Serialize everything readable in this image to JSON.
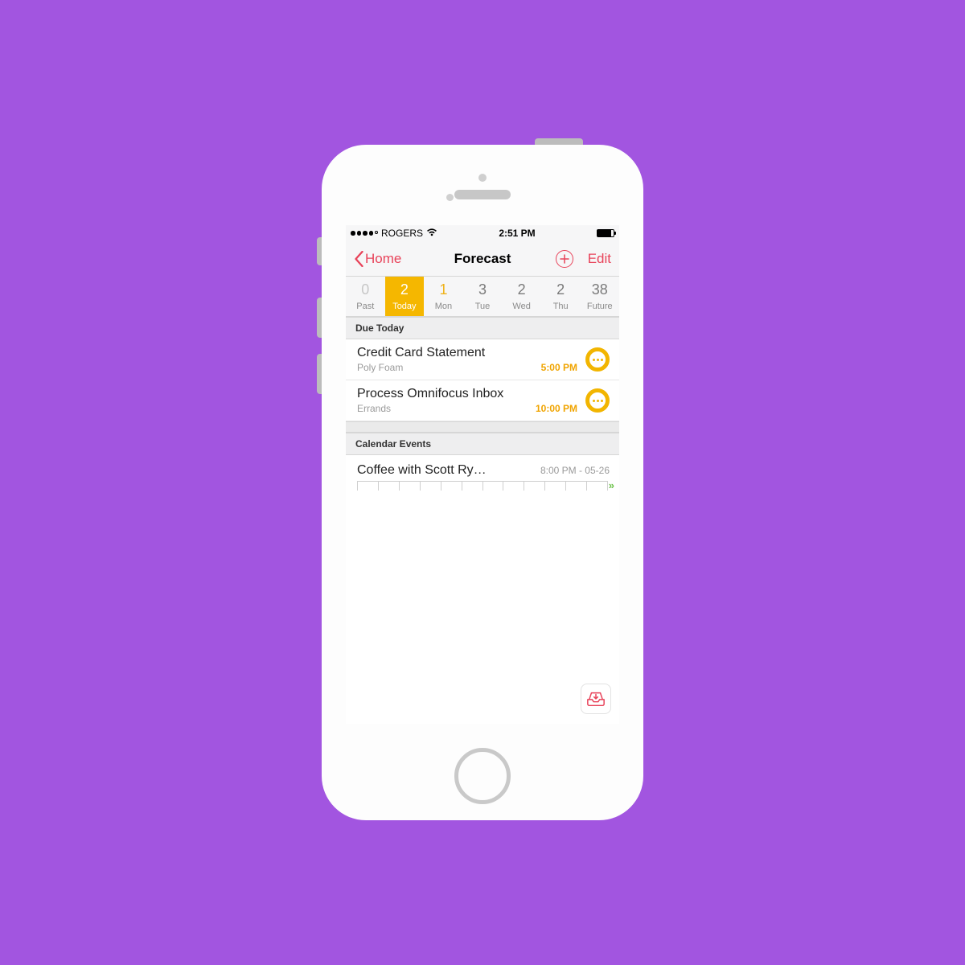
{
  "status_bar": {
    "carrier": "ROGERS",
    "time": "2:51 PM"
  },
  "nav": {
    "back_label": "Home",
    "title": "Forecast",
    "edit_label": "Edit"
  },
  "days": [
    {
      "count": "0",
      "label": "Past",
      "kind": "past"
    },
    {
      "count": "2",
      "label": "Today",
      "kind": "selected"
    },
    {
      "count": "1",
      "label": "Mon",
      "kind": "upcoming"
    },
    {
      "count": "3",
      "label": "Tue",
      "kind": "normal"
    },
    {
      "count": "2",
      "label": "Wed",
      "kind": "normal"
    },
    {
      "count": "2",
      "label": "Thu",
      "kind": "normal"
    },
    {
      "count": "38",
      "label": "Future",
      "kind": "normal"
    }
  ],
  "sections": {
    "due_today_header": "Due Today",
    "calendar_header": "Calendar Events"
  },
  "tasks": [
    {
      "title": "Credit Card Statement",
      "project": "Poly Foam",
      "time": "5:00 PM"
    },
    {
      "title": "Process Omnifocus Inbox",
      "project": "Errands",
      "time": "10:00 PM"
    }
  ],
  "events": [
    {
      "title": "Coffee with Scott Ry…",
      "time": "8:00 PM - 05-26"
    }
  ],
  "colors": {
    "accent": "#e8435a",
    "amber": "#f5b700",
    "bg": "#a255e0"
  }
}
